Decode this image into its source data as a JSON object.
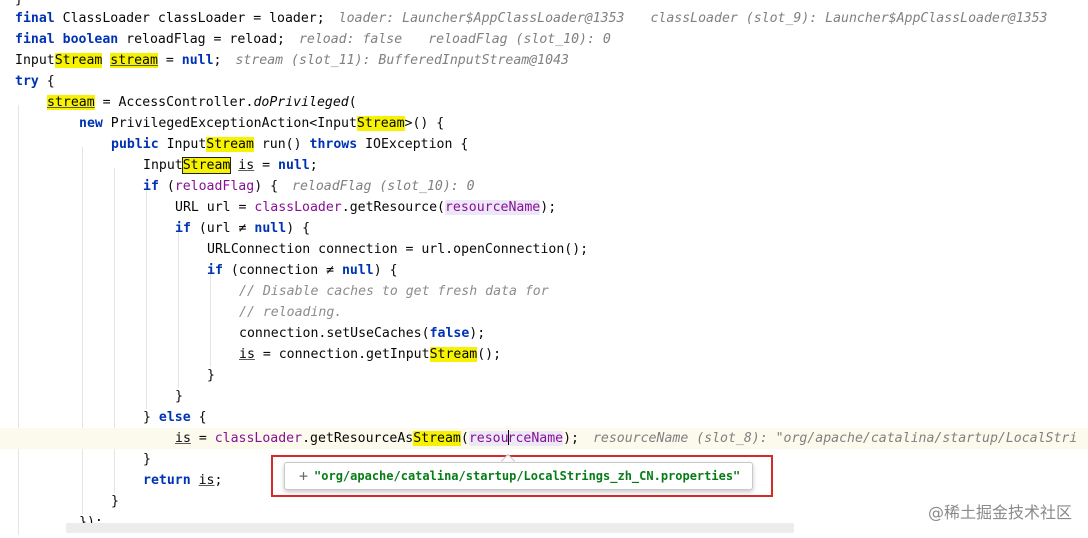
{
  "colors": {
    "keyword": "#0033b3",
    "field": "#871094",
    "comment": "#8c8c8c",
    "string": "#067d17",
    "search_highlight": "#f7f200",
    "annotation_border": "#d42a2a"
  },
  "code": {
    "l0": {
      "c": "}"
    },
    "l1": {
      "c0": "final",
      "c1": " ClassLoader classLoader = loader;",
      "h0": "loader: Launcher$AppClassLoader@1353",
      "h1": "classLoader (slot_9): Launcher$AppClassLoader@1353"
    },
    "l2": {
      "c0": "final",
      "c1": " ",
      "c2": "boolean",
      "c3": " reloadFlag = reload;",
      "h0": "reload: false",
      "h1": "reloadFlag (slot_10): 0"
    },
    "l3": {
      "c0": "Input",
      "c1": "Stream",
      "c2": " ",
      "c3": "stream",
      "c4": " = ",
      "c5": "null",
      "c6": ";",
      "h0": "stream (slot_11): BufferedInputStream@1043"
    },
    "l4": {
      "c0": "try",
      "c1": " {"
    },
    "l5": {
      "c0": "stream",
      "c1": " = AccessController.",
      "c2": "doPrivileged",
      "c3": "("
    },
    "l6": {
      "c0": "new",
      "c1": " PrivilegedExceptionAction<Input",
      "c2": "Stream",
      "c3": ">() {"
    },
    "l7": {
      "c0": "public",
      "c1": " Input",
      "c2": "Stream",
      "c3": " run() ",
      "c4": "throws",
      "c5": " IOException {"
    },
    "l8": {
      "c0": "Input",
      "c1": "Stream",
      "c2": " ",
      "c3": "is",
      "c4": " = ",
      "c5": "null",
      "c6": ";"
    },
    "l9": {
      "c0": "if",
      "c1": " (",
      "c2": "reloadFlag",
      "c3": ") {",
      "h0": "reloadFlag (slot_10): 0"
    },
    "l10": {
      "c0": "URL url = ",
      "c1": "classLoader",
      "c2": ".getResource(",
      "c3": "resourceName",
      "c4": ");"
    },
    "l11": {
      "c0": "if",
      "c1": " (url ≠ ",
      "c2": "null",
      "c3": ") {"
    },
    "l12": {
      "c": "URLConnection connection = url.openConnection();"
    },
    "l13": {
      "c0": "if",
      "c1": " (connection ≠ ",
      "c2": "null",
      "c3": ") {"
    },
    "l14": {
      "c": "// Disable caches to get fresh data for"
    },
    "l15": {
      "c": "// reloading."
    },
    "l16": {
      "c0": "connection.setUseCaches(",
      "c1": "false",
      "c2": ");"
    },
    "l17": {
      "c0": "is",
      "c1": " = connection.getInput",
      "c2": "Stream",
      "c3": "();"
    },
    "l18": {
      "c": "}"
    },
    "l19": {
      "c": "}"
    },
    "l20": {
      "c0": "} ",
      "c1": "else",
      "c2": " {"
    },
    "l21": {
      "c0": "is",
      "c1": " = ",
      "c2": "classLoader",
      "c3": ".getResourceAs",
      "c4": "Stream",
      "c5": "(",
      "c6": "resou",
      "c7": "rceName",
      "c8": ");",
      "h0": "resourceName (slot_8): \"org/apache/catalina/startup/LocalStri"
    },
    "l22": {
      "c": "}"
    },
    "l23": {
      "c0": "return",
      "c1": " ",
      "c2": "is",
      "c3": ";"
    },
    "l24": {
      "c": "}"
    },
    "l25": {
      "c": "});"
    }
  },
  "hint_popup": {
    "expand": "+",
    "value": "\"org/apache/catalina/startup/LocalStrings_zh_CN.properties\""
  },
  "watermark": "@稀土掘金技术社区"
}
